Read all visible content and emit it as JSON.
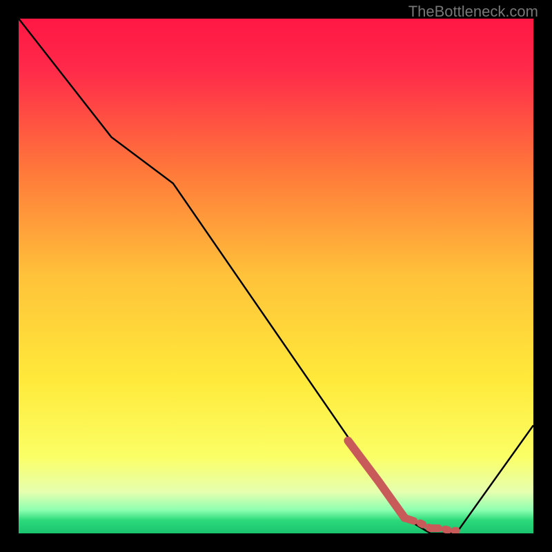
{
  "watermark": "TheBottleneck.com",
  "chart_data": {
    "type": "line",
    "title": "",
    "xlabel": "",
    "ylabel": "",
    "xlim": [
      0,
      100
    ],
    "ylim": [
      0,
      100
    ],
    "series": [
      {
        "name": "bottleneck-curve",
        "color": "#000000",
        "x": [
          0,
          18,
          30,
          70,
          75,
          80,
          85,
          100
        ],
        "values": [
          100,
          77,
          68,
          10,
          3,
          0,
          0,
          21
        ]
      },
      {
        "name": "highlight-segment",
        "color": "#c85a5a",
        "style": "dash-dot-thick",
        "x": [
          64,
          70,
          75,
          78,
          80,
          82,
          84,
          85
        ],
        "values": [
          18,
          10,
          3,
          2,
          1,
          1,
          0.5,
          0.5
        ]
      }
    ],
    "background_gradient": {
      "stops": [
        {
          "offset": 0.0,
          "color": "#ff1744"
        },
        {
          "offset": 0.1,
          "color": "#ff2a4a"
        },
        {
          "offset": 0.3,
          "color": "#ff7a3a"
        },
        {
          "offset": 0.5,
          "color": "#ffc23a"
        },
        {
          "offset": 0.7,
          "color": "#ffe93a"
        },
        {
          "offset": 0.85,
          "color": "#fbff65"
        },
        {
          "offset": 0.92,
          "color": "#e6ffb0"
        },
        {
          "offset": 0.955,
          "color": "#8cffb0"
        },
        {
          "offset": 0.975,
          "color": "#2bd97a"
        },
        {
          "offset": 1.0,
          "color": "#1bc470"
        }
      ]
    }
  }
}
